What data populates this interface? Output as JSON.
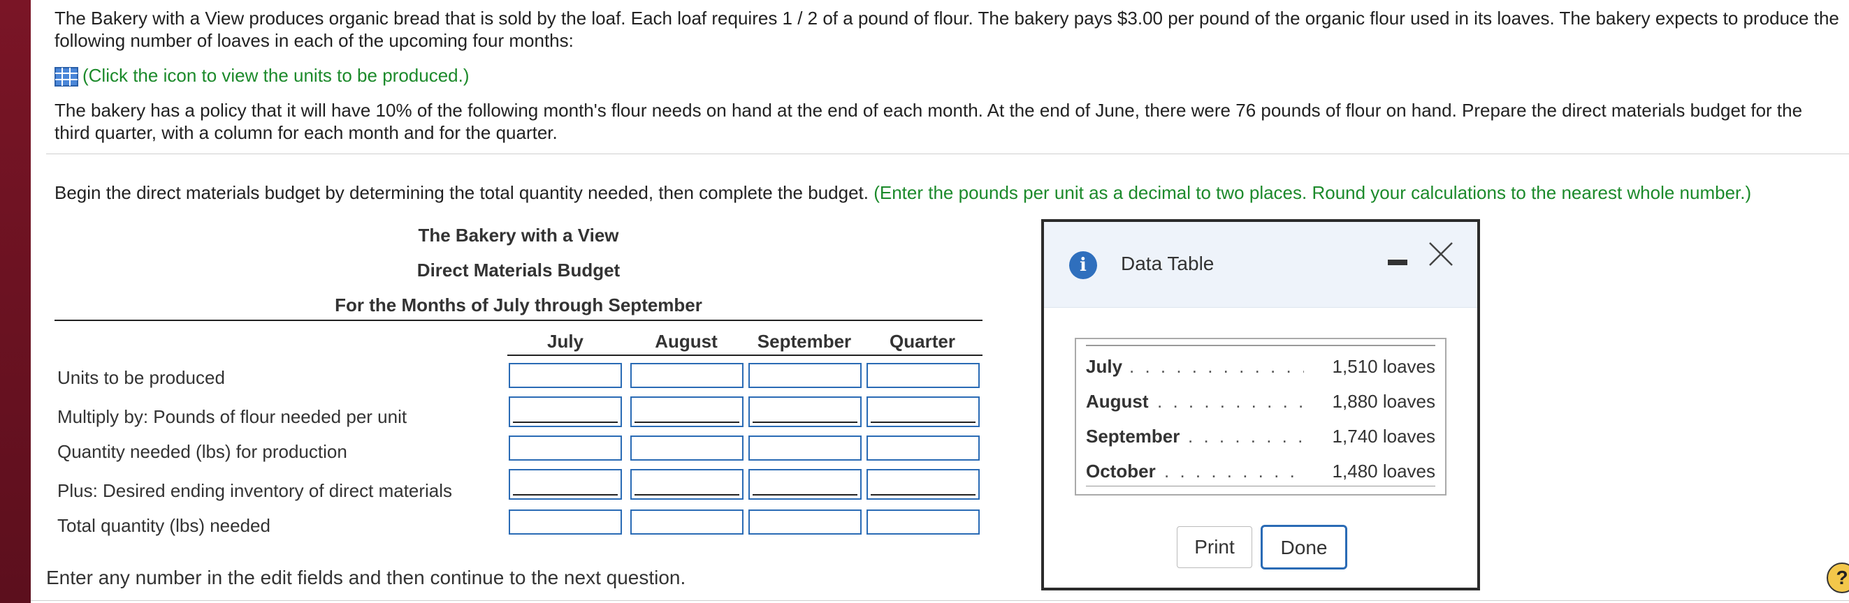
{
  "problem": {
    "intro_line1": "The Bakery with a View produces organic bread that is sold by the loaf. Each loaf requires 1 / 2 of a pound of flour. The bakery pays $3.00 per pound of the organic flour used in its loaves. The bakery expects to produce the",
    "intro_line2": "following number of loaves in each of the upcoming four months:",
    "icon_link": "(Click the icon to view the units to be produced.)",
    "policy_line1": "The bakery has a policy that it will have 10% of the following month's flour needs on hand at the end of each month. At the end of June, there were 76 pounds of flour on hand. Prepare the direct materials budget for the",
    "policy_line2": "third quarter, with a column for each month and for the quarter.",
    "instruction": "Begin the direct materials budget by determining the total quantity needed, then complete the budget. ",
    "instruction_hint": "(Enter the pounds per unit as a decimal to two places. Round your calculations to the nearest whole number.)"
  },
  "budget": {
    "company": "The Bakery with a View",
    "title": "Direct Materials Budget",
    "period": "For the Months of July through September",
    "columns": [
      "July",
      "August",
      "September",
      "Quarter"
    ],
    "rows": [
      "Units to be produced",
      "Multiply by: Pounds of flour needed per unit",
      "Quantity needed (lbs) for production",
      "Plus: Desired ending inventory of direct materials",
      "Total quantity (lbs) needed"
    ]
  },
  "footer": "Enter any number in the edit fields and then continue to the next question.",
  "modal": {
    "title": "Data Table",
    "rows": [
      {
        "month": "July",
        "dots": ". . . . . . . . . . . . . . . . . . . .",
        "value": "1,510 loaves"
      },
      {
        "month": "August",
        "dots": ". . . . . . . . . . . . . . . . .",
        "value": "1,880 loaves"
      },
      {
        "month": "September",
        "dots": ". . . . . . . . . . . . .",
        "value": "1,740 loaves"
      },
      {
        "month": "October",
        "dots": ". . . . . . . . . . . . . . .",
        "value": "1,480 loaves"
      }
    ],
    "print_label": "Print",
    "done_label": "Done"
  },
  "help_label": "?",
  "colors": {
    "accent": "#2a6bb5",
    "hint": "#1c8a2b",
    "sidebar": "#7a1526"
  }
}
